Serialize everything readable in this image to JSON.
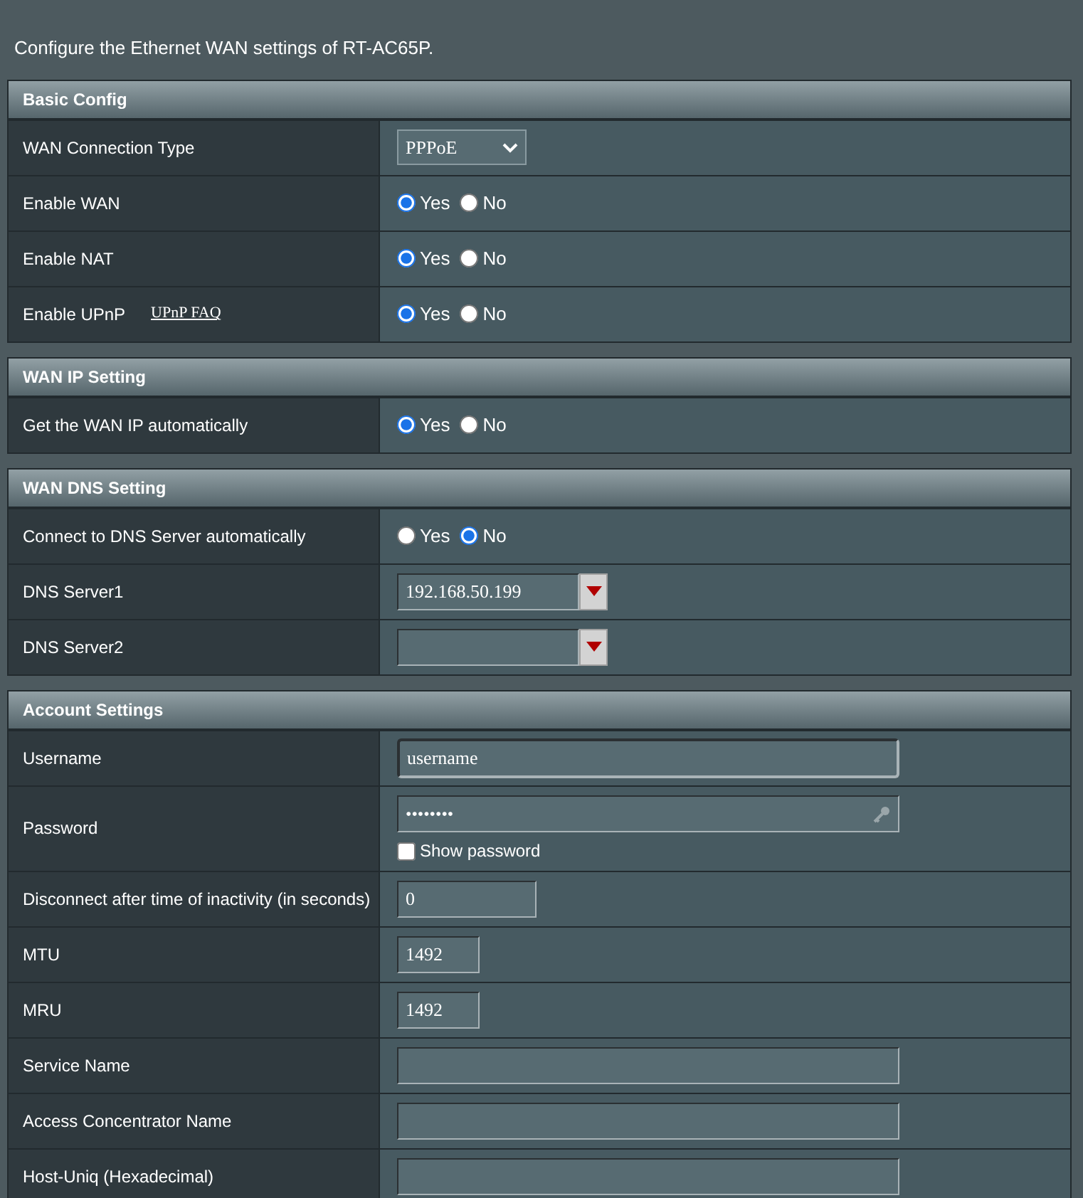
{
  "description": "Configure the Ethernet WAN settings of RT-AC65P.",
  "sections": [
    {
      "title": "Basic Config",
      "rows": [
        {
          "label": "WAN Connection Type",
          "kind": "select",
          "value": "PPPoE"
        },
        {
          "label": "Enable WAN",
          "kind": "radio",
          "options": [
            {
              "label": "Yes",
              "selected": true
            },
            {
              "label": "No",
              "selected": false
            }
          ]
        },
        {
          "label": "Enable NAT",
          "kind": "radio",
          "options": [
            {
              "label": "Yes",
              "selected": true
            },
            {
              "label": "No",
              "selected": false
            }
          ]
        },
        {
          "label": "Enable UPnP",
          "link": "UPnP FAQ",
          "kind": "radio",
          "options": [
            {
              "label": "Yes",
              "selected": true
            },
            {
              "label": "No",
              "selected": false
            }
          ]
        }
      ]
    },
    {
      "title": "WAN IP Setting",
      "rows": [
        {
          "label": "Get the WAN IP automatically",
          "kind": "radio",
          "options": [
            {
              "label": "Yes",
              "selected": true
            },
            {
              "label": "No",
              "selected": false
            }
          ]
        }
      ]
    },
    {
      "title": "WAN DNS Setting",
      "rows": [
        {
          "label": "Connect to DNS Server automatically",
          "kind": "radio",
          "options": [
            {
              "label": "Yes",
              "selected": false
            },
            {
              "label": "No",
              "selected": true
            }
          ]
        },
        {
          "label": "DNS Server1",
          "kind": "combo",
          "value": "192.168.50.199"
        },
        {
          "label": "DNS Server2",
          "kind": "combo"
        }
      ]
    },
    {
      "title": "Account Settings",
      "rows": [
        {
          "label": "Username",
          "kind": "wide",
          "value": "username",
          "focused": true
        },
        {
          "label": "Password",
          "kind": "password",
          "value": "••••••••",
          "show_label": "Show password",
          "checked": false
        },
        {
          "label": "Disconnect after time of inactivity (in seconds)",
          "kind": "medium",
          "value": "0"
        },
        {
          "label": "MTU",
          "kind": "short",
          "value": "1492"
        },
        {
          "label": "MRU",
          "kind": "short",
          "value": "1492"
        },
        {
          "label": "Service Name",
          "kind": "wide"
        },
        {
          "label": "Access Concentrator Name",
          "kind": "wide"
        },
        {
          "label": "Host-Uniq (Hexadecimal)",
          "kind": "wide"
        }
      ]
    }
  ]
}
